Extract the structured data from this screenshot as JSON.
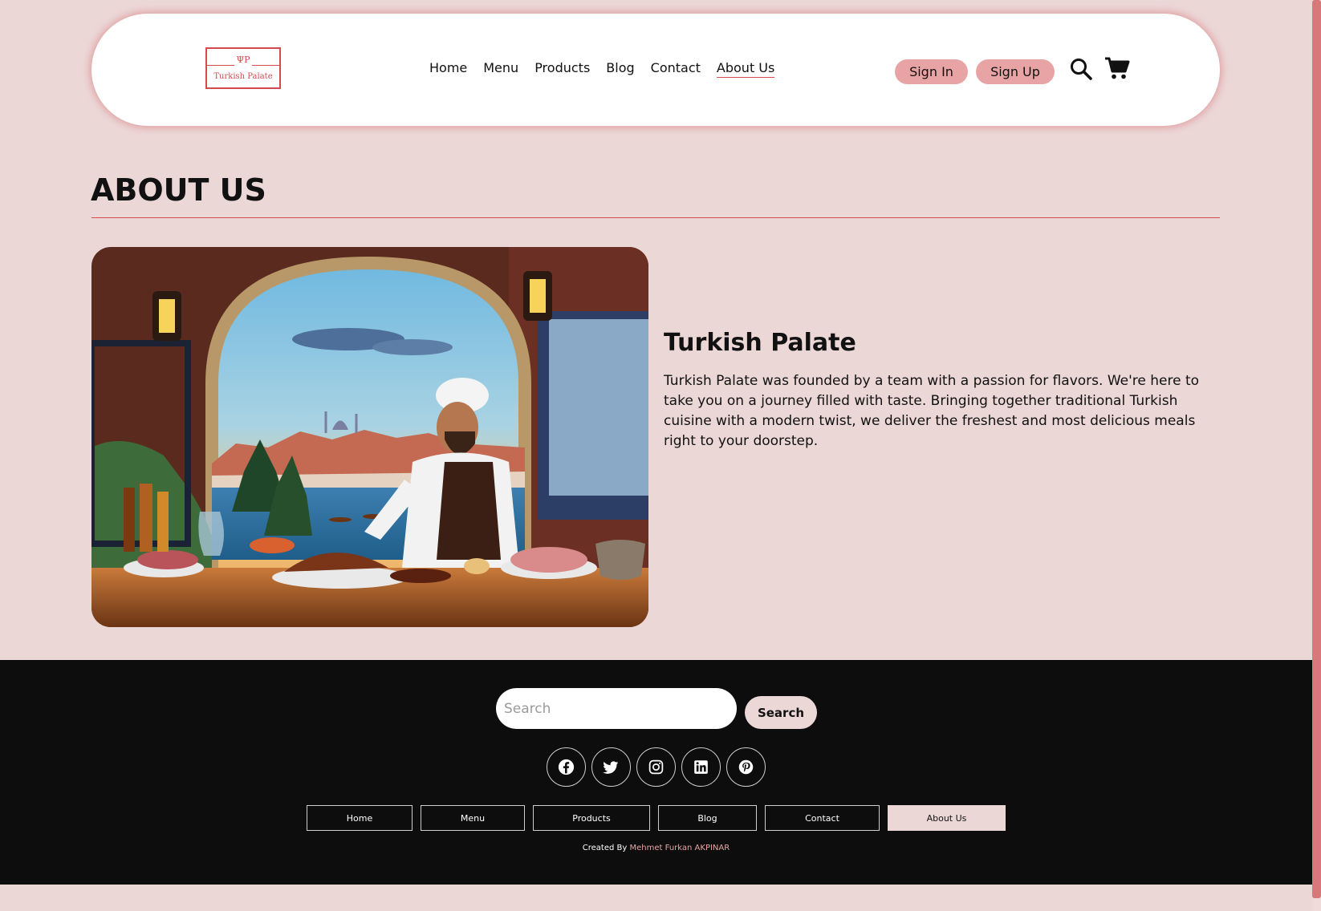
{
  "header": {
    "logo": {
      "name": "Turkish Palate",
      "mark": "ΨΡ"
    },
    "nav": [
      {
        "label": "Home"
      },
      {
        "label": "Menu"
      },
      {
        "label": "Products"
      },
      {
        "label": "Blog"
      },
      {
        "label": "Contact"
      },
      {
        "label": "About Us",
        "active": true
      }
    ],
    "sign_in": "Sign In",
    "sign_up": "Sign Up",
    "icons": [
      "search-icon",
      "cart-icon"
    ]
  },
  "about": {
    "title": "ABOUT US",
    "image": {
      "description_icon": "chef-illustration"
    },
    "heading": "Turkish Palate",
    "text": "Turkish Palate was founded by a team with a passion for flavors. We're here to take you on a journey filled with taste. Bringing together traditional Turkish cuisine with a modern twist, we deliver the freshest and most delicious meals right to your doorstep."
  },
  "footer": {
    "search": {
      "placeholder": "Search",
      "value": "",
      "button": "Search"
    },
    "socials": [
      "facebook-icon",
      "twitter-icon",
      "instagram-icon",
      "linkedin-icon",
      "pinterest-icon"
    ],
    "nav": [
      {
        "label": "Home"
      },
      {
        "label": "Menu"
      },
      {
        "label": "Products"
      },
      {
        "label": "Blog"
      },
      {
        "label": "Contact"
      },
      {
        "label": "About Us",
        "active": true
      }
    ],
    "credit_prefix": "Created By",
    "credit_author": "Mehmet Furkan AKPINAR"
  },
  "colors": {
    "background": "#ecd7d7",
    "accent": "#d64a4f",
    "button": "#e8a4a4",
    "footer": "#0d0d0d"
  }
}
